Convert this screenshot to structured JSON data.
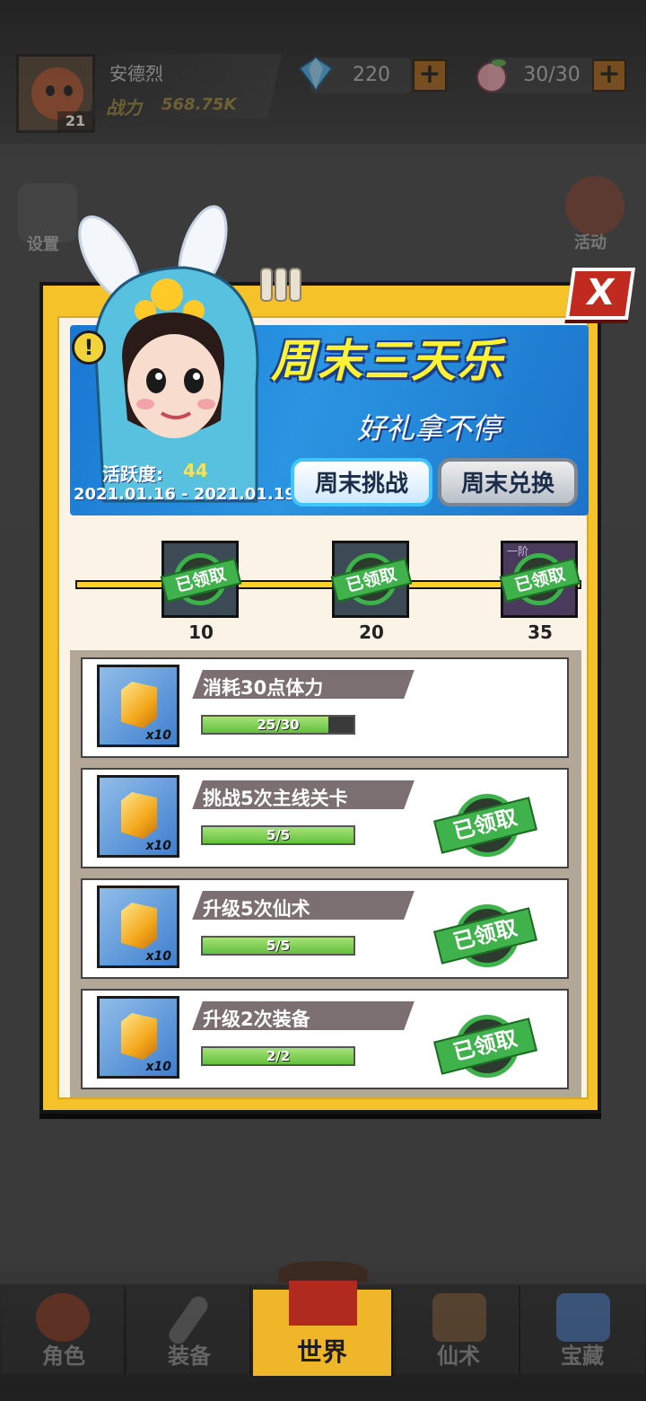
{
  "header": {
    "player_name": "安德烈",
    "level": "21",
    "power_label": "战力",
    "power_value": "568.75K",
    "gems": "220",
    "stamina": "30/30"
  },
  "side_menu": {
    "settings_label": "设置",
    "activity_label": "活动"
  },
  "event": {
    "title": "周末三天乐",
    "subtitle": "好礼拿不停",
    "activity_label": "活跃度:",
    "activity_value": "44",
    "date_range": "2021.01.16 - 2021.01.19",
    "challenge_tab": "周末挑战",
    "exchange_tab": "周末兑换",
    "close": "X"
  },
  "milestones": [
    {
      "threshold": "10",
      "status": "已领取"
    },
    {
      "threshold": "20",
      "status": "已领取"
    },
    {
      "threshold": "35",
      "status": "已领取",
      "tier": "一阶"
    }
  ],
  "tasks": [
    {
      "title": "消耗30点体力",
      "reward_qty": "x10",
      "progress_text": "25/30",
      "progress": 0.8333,
      "status": ""
    },
    {
      "title": "挑战5次主线关卡",
      "reward_qty": "x10",
      "progress_text": "5/5",
      "progress": 1.0,
      "status": "已领取"
    },
    {
      "title": "升级5次仙术",
      "reward_qty": "x10",
      "progress_text": "5/5",
      "progress": 1.0,
      "status": "已领取"
    },
    {
      "title": "升级2次装备",
      "reward_qty": "x10",
      "progress_text": "2/2",
      "progress": 1.0,
      "status": "已领取"
    }
  ],
  "bottom_nav": [
    {
      "label": "角色",
      "active": false
    },
    {
      "label": "装备",
      "active": false
    },
    {
      "label": "世界",
      "active": true
    },
    {
      "label": "仙术",
      "active": false
    },
    {
      "label": "宝藏",
      "active": false
    }
  ],
  "colors": {
    "dialog_frame": "#f6c22a",
    "claimed_green": "#3fb24b",
    "banner_blue": "#2a95e2",
    "title_yellow": "#fff233"
  }
}
